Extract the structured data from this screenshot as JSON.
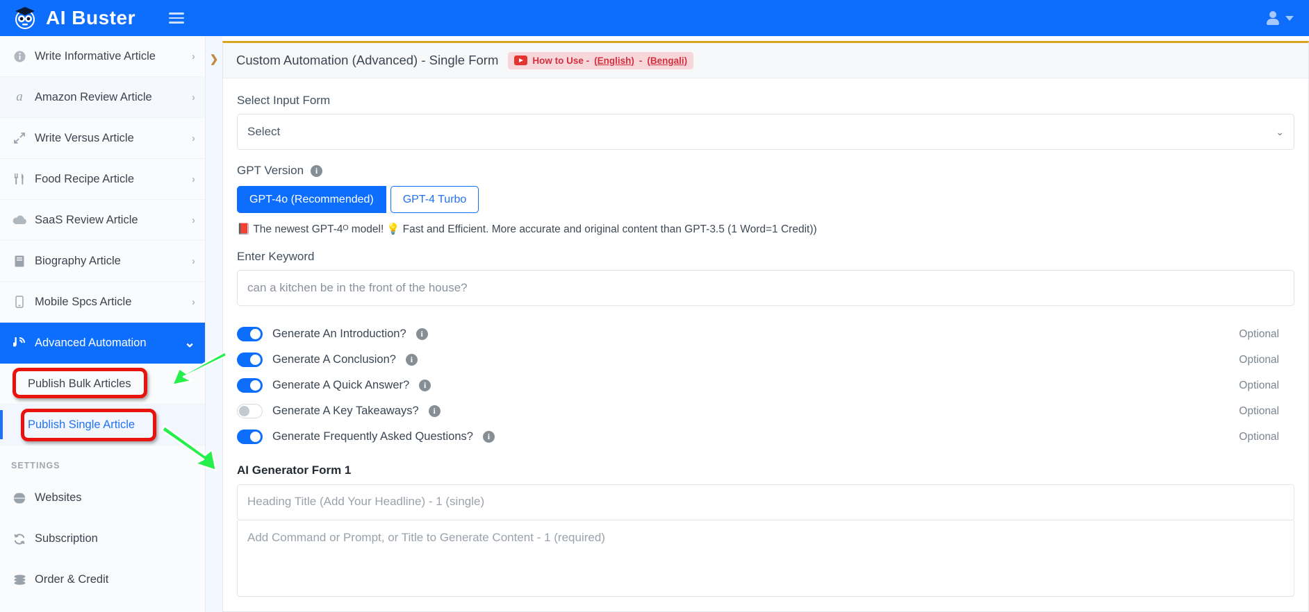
{
  "topbar": {
    "brand": "AI Buster",
    "logo_icon": "robot-graduate-logo",
    "menu_icon": "hamburger-icon",
    "user_icon": "user-avatar-icon",
    "caret_icon": "chevron-down-icon",
    "brand_color": "#0d6efd"
  },
  "sidebar": {
    "items": [
      {
        "label": "Write Informative Article",
        "icon": "info-circle-icon",
        "glyph": "ℹ",
        "chevron": "›"
      },
      {
        "label": "Amazon Review Article",
        "icon": "amazon-icon",
        "glyph": "a",
        "chevron": "›"
      },
      {
        "label": "Write Versus Article",
        "icon": "arrows-versus-icon",
        "glyph": "⇲",
        "chevron": "›"
      },
      {
        "label": "Food Recipe Article",
        "icon": "fork-knife-icon",
        "glyph": "🍴",
        "chevron": "›"
      },
      {
        "label": "SaaS Review Article",
        "icon": "cloud-icon",
        "glyph": "☁",
        "chevron": "›"
      },
      {
        "label": "Biography Article",
        "icon": "book-icon",
        "glyph": "📕",
        "chevron": "›"
      },
      {
        "label": "Mobile Spcs Article",
        "icon": "mobile-phone-icon",
        "glyph": "📱",
        "chevron": "›"
      }
    ],
    "active_item": {
      "label": "Advanced Automation",
      "icon": "broadcast-icon",
      "glyph": "ɓ",
      "chevron": "⌄"
    },
    "subitems": [
      {
        "label": "Publish Bulk Articles",
        "selected": false
      },
      {
        "label": "Publish Single Article",
        "selected": true
      }
    ],
    "settings_heading": "SETTINGS",
    "settings_items": [
      {
        "label": "Websites",
        "icon": "globe-icon",
        "glyph": "🌐"
      },
      {
        "label": "Subscription",
        "icon": "refresh-cycle-icon",
        "glyph": "↻"
      },
      {
        "label": "Order & Credit",
        "icon": "coins-stack-icon",
        "glyph": "≡"
      }
    ]
  },
  "annotations": {
    "box_color": "#e8130c",
    "arrow_color": "#25ef4a",
    "boxes": [
      "publish-bulk-articles-highlight",
      "publish-single-article-highlight"
    ],
    "arrows": [
      "arrow-to-publish-bulk-articles",
      "arrow-to-publish-single-article"
    ]
  },
  "content": {
    "collapse_icon": "chevron-right-icon",
    "card_title": "Custom Automation (Advanced) - Single Form",
    "howto": {
      "video_icon": "youtube-play-icon",
      "prefix": "How to Use - ",
      "link_english": "(English)",
      "separator": " - ",
      "link_bengali": "(Bengali)"
    },
    "select_input_form": {
      "label": "Select Input Form",
      "value": "Select",
      "caret_icon": "chevron-down-icon"
    },
    "gpt_version": {
      "label": "GPT Version",
      "info_icon": "info-icon",
      "buttons": [
        {
          "label": "GPT-4o (Recommended)",
          "active": true
        },
        {
          "label": "GPT-4 Turbo",
          "active": false
        }
      ],
      "description_icon_1": "red-book-icon",
      "description_part_1": "The newest GPT-4ᴼ model!",
      "description_icon_2": "lightbulb-icon",
      "description_part_2": "Fast and Efficient. More accurate and original content than GPT-3.5 (1 Word=1 Credit))"
    },
    "keyword": {
      "label": "Enter Keyword",
      "placeholder": "can a kitchen be in the front of the house?",
      "value": ""
    },
    "toggles": [
      {
        "label": "Generate An Introduction?",
        "on": true,
        "info_icon": "info-icon",
        "optional": "Optional"
      },
      {
        "label": "Generate A Conclusion?",
        "on": true,
        "info_icon": "info-icon",
        "optional": "Optional"
      },
      {
        "label": "Generate A Quick Answer?",
        "on": true,
        "info_icon": "info-icon",
        "optional": "Optional"
      },
      {
        "label": "Generate A Key Takeaways?",
        "on": false,
        "info_icon": "info-icon",
        "optional": "Optional"
      },
      {
        "label": "Generate Frequently Asked Questions?",
        "on": true,
        "info_icon": "info-icon",
        "optional": "Optional"
      }
    ],
    "generator_form": {
      "title": "AI Generator Form 1",
      "heading_placeholder": "Heading Title (Add Your Headline) - 1 (single)",
      "prompt_placeholder": "Add Command or Prompt, or Title to Generate Content - 1 (required)"
    }
  }
}
